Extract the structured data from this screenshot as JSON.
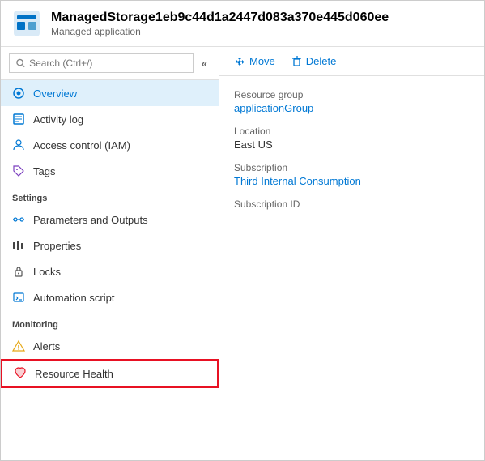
{
  "header": {
    "title": "ManagedStorage1eb9c44d1a2447d083a370e445d060ee",
    "subtitle": "Managed application"
  },
  "search": {
    "placeholder": "Search (Ctrl+/)"
  },
  "collapse_btn": "«",
  "nav": {
    "top_items": [
      {
        "id": "overview",
        "label": "Overview",
        "active": true
      },
      {
        "id": "activity-log",
        "label": "Activity log",
        "active": false
      },
      {
        "id": "access-control",
        "label": "Access control (IAM)",
        "active": false
      },
      {
        "id": "tags",
        "label": "Tags",
        "active": false
      }
    ],
    "settings_label": "Settings",
    "settings_items": [
      {
        "id": "parameters-outputs",
        "label": "Parameters and Outputs",
        "active": false
      },
      {
        "id": "properties",
        "label": "Properties",
        "active": false
      },
      {
        "id": "locks",
        "label": "Locks",
        "active": false
      },
      {
        "id": "automation-script",
        "label": "Automation script",
        "active": false
      }
    ],
    "monitoring_label": "Monitoring",
    "monitoring_items": [
      {
        "id": "alerts",
        "label": "Alerts",
        "active": false
      },
      {
        "id": "resource-health",
        "label": "Resource Health",
        "active": false,
        "highlighted": true
      }
    ]
  },
  "toolbar": {
    "move_label": "Move",
    "delete_label": "Delete"
  },
  "info": {
    "resource_group_label": "Resource group",
    "resource_group_value": "applicationGroup",
    "location_label": "Location",
    "location_value": "East US",
    "subscription_label": "Subscription",
    "subscription_value": "Third Internal Consumption",
    "subscription_id_label": "Subscription ID",
    "subscription_id_value": ""
  }
}
